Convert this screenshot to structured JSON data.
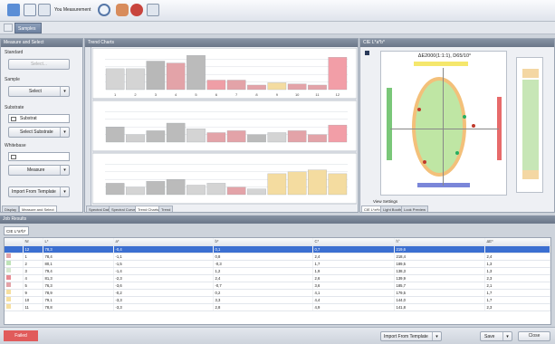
{
  "toolbar": {
    "title": "You Measurement",
    "icons": [
      "instrument-icon",
      "measure-icon",
      "document-icon",
      "search-icon",
      "hand-icon",
      "target-icon",
      "grid-icon"
    ]
  },
  "tabstrip": {
    "label": "Samples"
  },
  "left_panel": {
    "title": "Measure and Select",
    "standard_label": "Standard",
    "standard_button": "Select...",
    "sample_label": "Sample",
    "sample_select": "Select",
    "substrate_label": "Substrate",
    "substrate_checkbox": "Substrat",
    "substrate_button": "Select Substrate",
    "whitebase_label": "Whitebase",
    "measure_button": "Measure",
    "import_button": "Import From Template",
    "tabs": [
      "Display",
      "Measure and Select"
    ]
  },
  "trend_panel": {
    "title": "Trend Charts",
    "tabs": [
      "Spectral Data",
      "Spectral Curves",
      "Trend Charts",
      "Trend"
    ]
  },
  "cielab_panel": {
    "title": "CIE L*a*b*",
    "plot_title": "ΔE2000(1:1:1), D65/10°",
    "view_settings": "View Settings",
    "tabs": [
      "CIE L*a*b*",
      "Light Booth",
      "Look Preview"
    ]
  },
  "results": {
    "title": "Job Results",
    "tab": "CIE L*a*b*",
    "columns": [
      "Nr",
      "L*",
      "a*",
      "b*",
      "C*",
      "h°",
      "ΔE*"
    ],
    "rows": [
      {
        "nr": "12",
        "L": "78,3",
        "a": "-0,4",
        "b": "0,1",
        "C": "0,7",
        "h": "219,6",
        "dE": "",
        "color": "#3b6fd1"
      },
      {
        "nr": "1",
        "L": "78,4",
        "a": "-1,1",
        "b": "0,8",
        "C": "2,4",
        "h": "218,4",
        "dE": "2,4",
        "color": "#e3a3a8"
      },
      {
        "nr": "2",
        "L": "80,1",
        "a": "-1,5",
        "b": "-0,3",
        "C": "1,7",
        "h": "189,5",
        "dE": "1,3",
        "color": "#bfe3b8"
      },
      {
        "nr": "3",
        "L": "79,4",
        "a": "-1,4",
        "b": "1,2",
        "C": "1,9",
        "h": "138,3",
        "dE": "1,3",
        "color": "#d7e8d0"
      },
      {
        "nr": "4",
        "L": "81,3",
        "a": "-2,3",
        "b": "2,4",
        "C": "2,6",
        "h": "139,9",
        "dE": "2,3",
        "color": "#e98a92"
      },
      {
        "nr": "5",
        "L": "76,3",
        "a": "-3,6",
        "b": "-0,7",
        "C": "3,6",
        "h": "185,7",
        "dE": "2,1",
        "color": "#e3a3a8"
      },
      {
        "nr": "9",
        "L": "78,9",
        "a": "-0,2",
        "b": "0,2",
        "C": "4,1",
        "h": "179,5",
        "dE": "1,7",
        "color": "#f6dfa0"
      },
      {
        "nr": "10",
        "L": "79,1",
        "a": "-3,3",
        "b": "3,3",
        "C": "4,4",
        "h": "144,0",
        "dE": "1,7",
        "color": "#f6dfa0"
      },
      {
        "nr": "11",
        "L": "78,8",
        "a": "-3,3",
        "b": "2,8",
        "C": "4,9",
        "h": "141,8",
        "dE": "2,3",
        "color": "#f6dfa0"
      }
    ]
  },
  "statusbar": {
    "status": "Failed",
    "import_label": "Import From Template",
    "save_label": "Save",
    "close_label": "Close"
  },
  "chart_data": [
    {
      "type": "bar",
      "categories": [
        "1",
        "2",
        "3",
        "4",
        "5",
        "6",
        "7",
        "8",
        "9",
        "10",
        "11",
        "12"
      ],
      "values": [
        55,
        55,
        75,
        70,
        90,
        25,
        25,
        12,
        18,
        15,
        12,
        85
      ],
      "colors": [
        "#d4d4d4",
        "#d4d4d4",
        "#b8b8b8",
        "#e3a3a8",
        "#bbbbbb",
        "#ef9ea6",
        "#e3a3a8",
        "#e3a3a8",
        "#f4dca0",
        "#e3a3a8",
        "#e3a3a8",
        "#f29ea7"
      ]
    },
    {
      "type": "bar",
      "categories": [
        "1",
        "2",
        "3",
        "4",
        "5",
        "6",
        "7",
        "8",
        "9",
        "10",
        "11",
        "12"
      ],
      "values": [
        40,
        20,
        30,
        50,
        35,
        25,
        30,
        20,
        25,
        30,
        20,
        45
      ],
      "colors": [
        "#bbbbbb",
        "#cfcfcf",
        "#bbbbbb",
        "#bbbbbb",
        "#d4d4d4",
        "#e3a3a8",
        "#e3a3a8",
        "#bbbbbb",
        "#d4d4d4",
        "#e3a3a8",
        "#e3a3a8",
        "#f29ea7"
      ]
    },
    {
      "type": "bar",
      "categories": [
        "1",
        "2",
        "3",
        "4",
        "5",
        "6",
        "7",
        "8",
        "9",
        "10",
        "11",
        "12"
      ],
      "values": [
        30,
        20,
        35,
        40,
        25,
        30,
        20,
        15,
        55,
        60,
        65,
        55
      ],
      "colors": [
        "#bbbbbb",
        "#d4d4d4",
        "#bbbbbb",
        "#bbbbbb",
        "#d4d4d4",
        "#d4d4d4",
        "#e3a3a8",
        "#d4d4d4",
        "#f4dca0",
        "#f4dca0",
        "#f4dca0",
        "#f4dca0"
      ]
    }
  ]
}
